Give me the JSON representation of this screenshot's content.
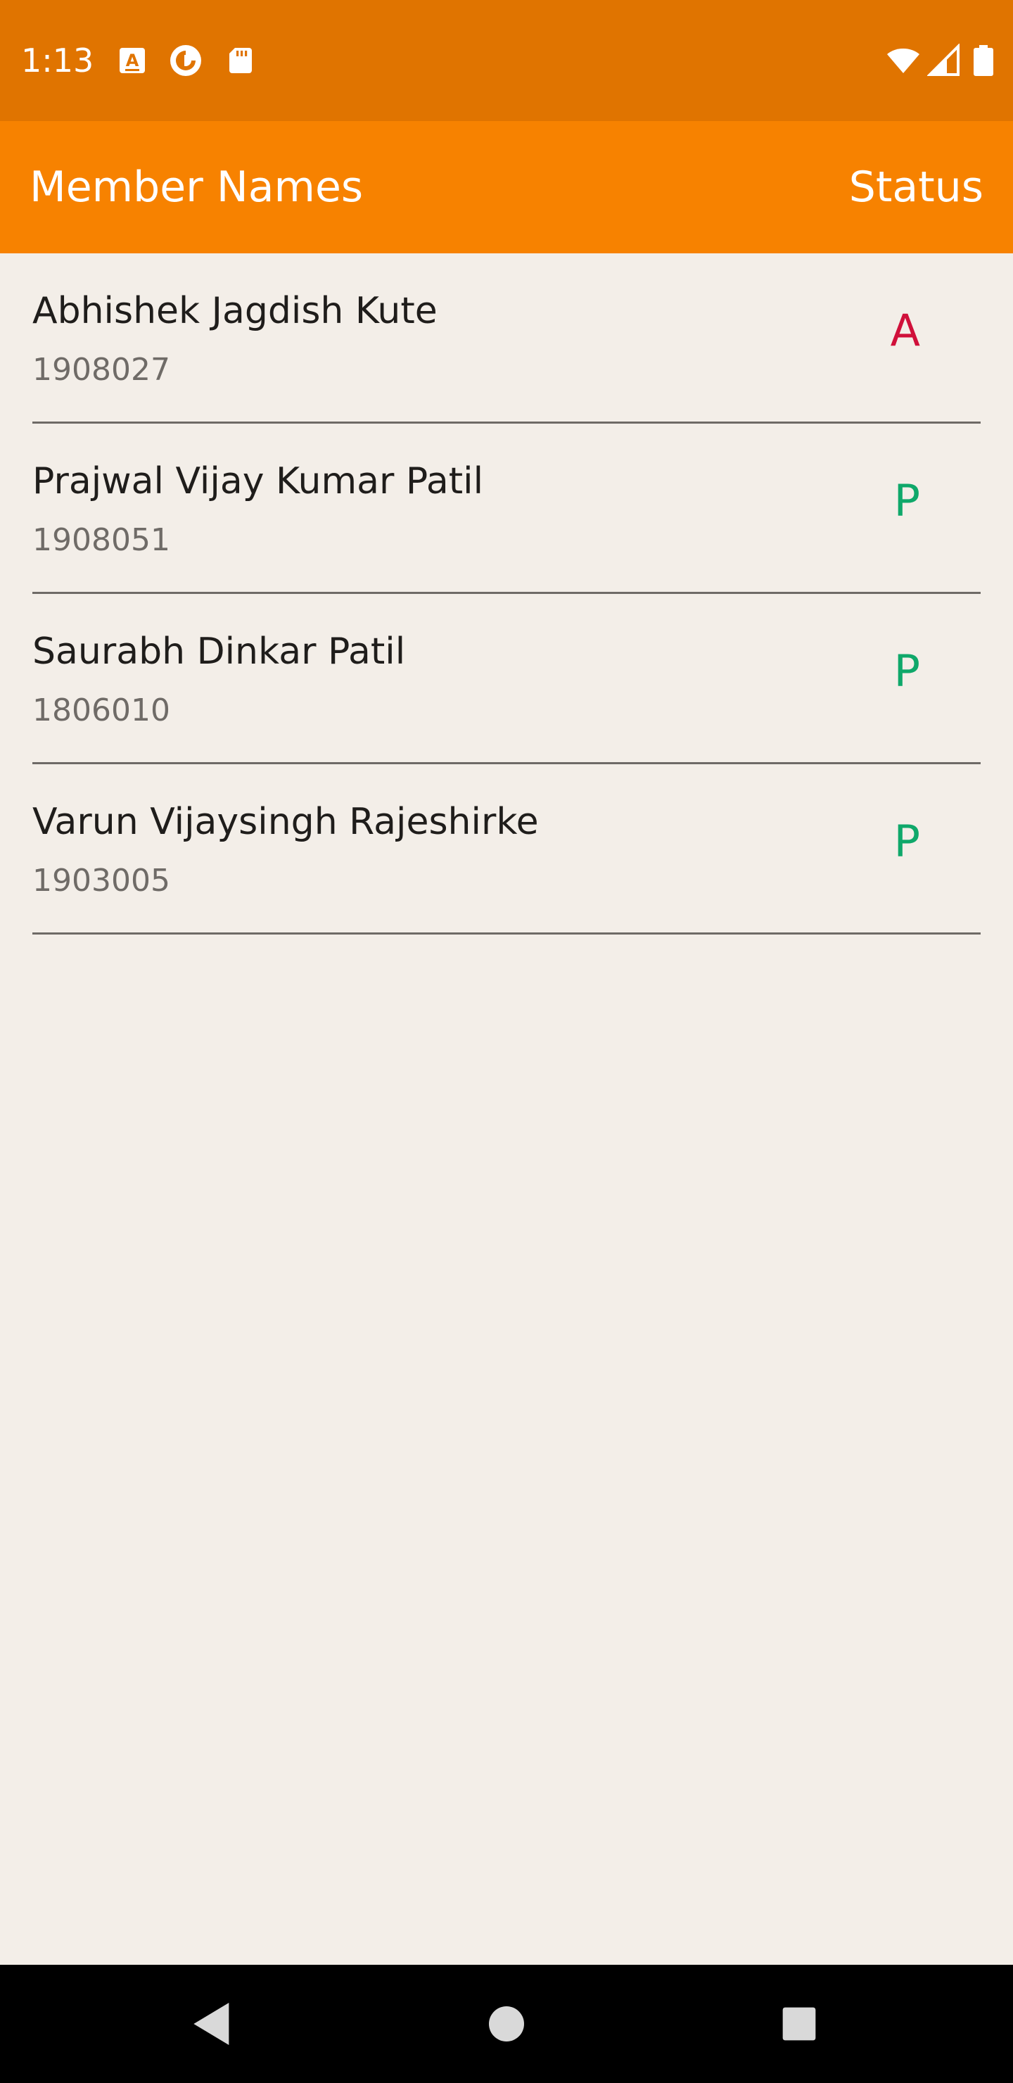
{
  "status_bar": {
    "time": "1:13",
    "icons": [
      "keyboard-a-icon",
      "pocket-casts-icon",
      "sd-card-icon",
      "wifi-icon",
      "cell-signal-icon",
      "battery-icon"
    ]
  },
  "app_bar": {
    "title": "Member Names",
    "status_label": "Status",
    "color": "#f78200"
  },
  "members": [
    {
      "name": "Abhishek Jagdish Kute",
      "id": "1908027",
      "status": "A"
    },
    {
      "name": "Prajwal Vijay Kumar Patil",
      "id": "1908051",
      "status": "P"
    },
    {
      "name": "Saurabh Dinkar Patil",
      "id": "1806010",
      "status": "P"
    },
    {
      "name": "Varun Vijaysingh Rajeshirke",
      "id": "1903005",
      "status": "P"
    }
  ],
  "colors": {
    "status_bar": "#e07400",
    "absent": "#d0103a",
    "present": "#0fa86a",
    "background": "#f3eee8"
  },
  "nav_bar": {
    "buttons": [
      "back-icon",
      "home-icon",
      "recents-icon"
    ]
  }
}
